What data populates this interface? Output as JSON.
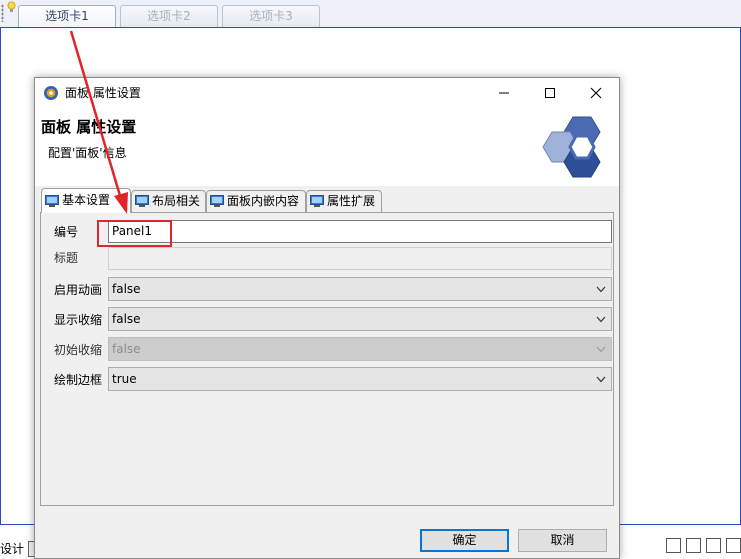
{
  "designer": {
    "tabs": [
      {
        "label": "选项卡1",
        "active": true
      },
      {
        "label": "选项卡2",
        "active": false
      },
      {
        "label": "选项卡3",
        "active": false
      }
    ],
    "bottom_left_label": "设计"
  },
  "dialog": {
    "window_title": "面板 属性设置",
    "header_title": "面板 属性设置",
    "header_subtitle": "配置'面板'信息",
    "tabs": [
      {
        "label": "基本设置",
        "icon": "monitor-icon",
        "active": true
      },
      {
        "label": "布局相关",
        "icon": "monitor-icon",
        "active": false
      },
      {
        "label": "面板内嵌内容",
        "icon": "monitor-icon",
        "active": false
      },
      {
        "label": "属性扩展",
        "icon": "monitor-icon",
        "active": false
      }
    ],
    "fields": {
      "id": {
        "label": "编号",
        "value": "Panel1"
      },
      "title": {
        "label": "标题",
        "value": ""
      },
      "enable_animation": {
        "label": "启用动画",
        "value": "false"
      },
      "show_collapse": {
        "label": "显示收缩",
        "value": "false"
      },
      "initial_collapse": {
        "label": "初始收缩",
        "value": "false",
        "disabled": true
      },
      "draw_border": {
        "label": "绘制边框",
        "value": "true"
      }
    },
    "buttons": {
      "ok": "确定",
      "cancel": "取消"
    }
  },
  "colors": {
    "accent_blue": "#0078d7",
    "annotation_red": "#e0252b",
    "canvas_border": "#2b49c9"
  }
}
